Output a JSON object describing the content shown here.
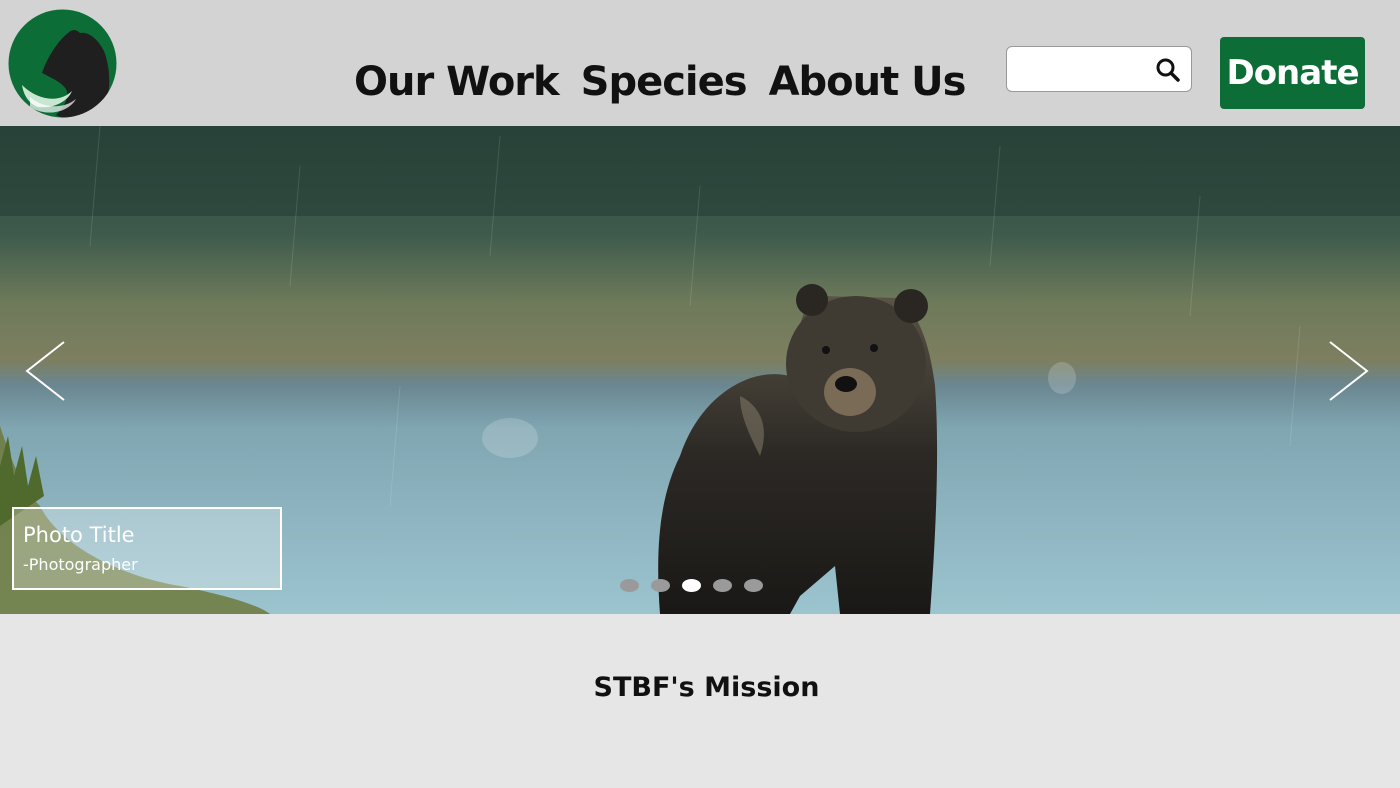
{
  "header": {
    "logo_icon": "bear-logo-icon",
    "nav": [
      {
        "label": "Our Work"
      },
      {
        "label": "Species"
      },
      {
        "label": "About Us"
      }
    ],
    "search": {
      "value": "",
      "placeholder": "",
      "icon": "search-icon"
    },
    "donate_label": "Donate"
  },
  "hero": {
    "photo": "grizzly-bear-in-rain-photo",
    "prev_icon": "chevron-left-icon",
    "next_icon": "chevron-right-icon",
    "caption": {
      "title": "Photo Title",
      "credit": "-Photographer"
    },
    "slides_total": 5,
    "active_slide": 3
  },
  "mission": {
    "title": "STBF's Mission"
  },
  "colors": {
    "header_bg": "#d3d3d3",
    "brand_green": "#0c6e36",
    "page_bg": "#e6e6e6"
  }
}
